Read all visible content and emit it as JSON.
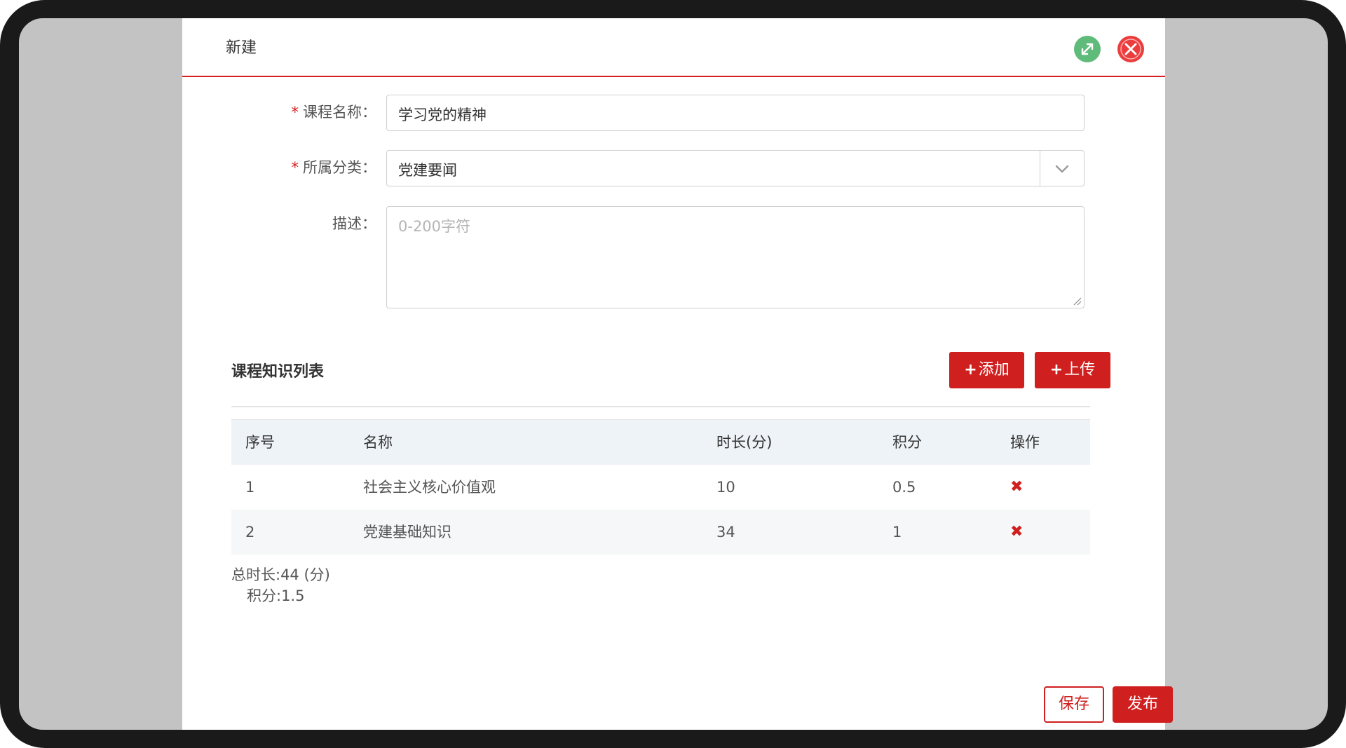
{
  "modal": {
    "title": "新建"
  },
  "form": {
    "course_name": {
      "required_mark": "*",
      "label": "课程名称：",
      "value": "学习党的精神"
    },
    "category": {
      "required_mark": "*",
      "label": "所属分类：",
      "value": "党建要闻"
    },
    "description": {
      "label": "描述：",
      "placeholder": "0-200字符"
    }
  },
  "knowledge": {
    "title": "课程知识列表",
    "add_label": "添加",
    "upload_label": "上传",
    "plus": "+",
    "columns": [
      "序号",
      "名称",
      "时长(分)",
      "积分",
      "操作"
    ],
    "rows": [
      {
        "index": "1",
        "name": "社会主义核心价值观",
        "duration": "10",
        "points": "0.5",
        "action": "✖"
      },
      {
        "index": "2",
        "name": "党建基础知识",
        "duration": "34",
        "points": "1",
        "action": "✖"
      }
    ],
    "total_duration": "总时长:44 (分)",
    "total_points": "积分:1.5"
  },
  "footer": {
    "save_label": "保存",
    "publish_label": "发布"
  },
  "colors": {
    "brand_red": "#cf1f1f",
    "expand_green": "#5fbb7a",
    "close_red": "#ec3d3e"
  },
  "icons": {
    "expand": "expand-arrows-icon",
    "close": "close-x-icon",
    "dropdown": "chevron-down-icon",
    "delete": "delete-x-icon"
  }
}
